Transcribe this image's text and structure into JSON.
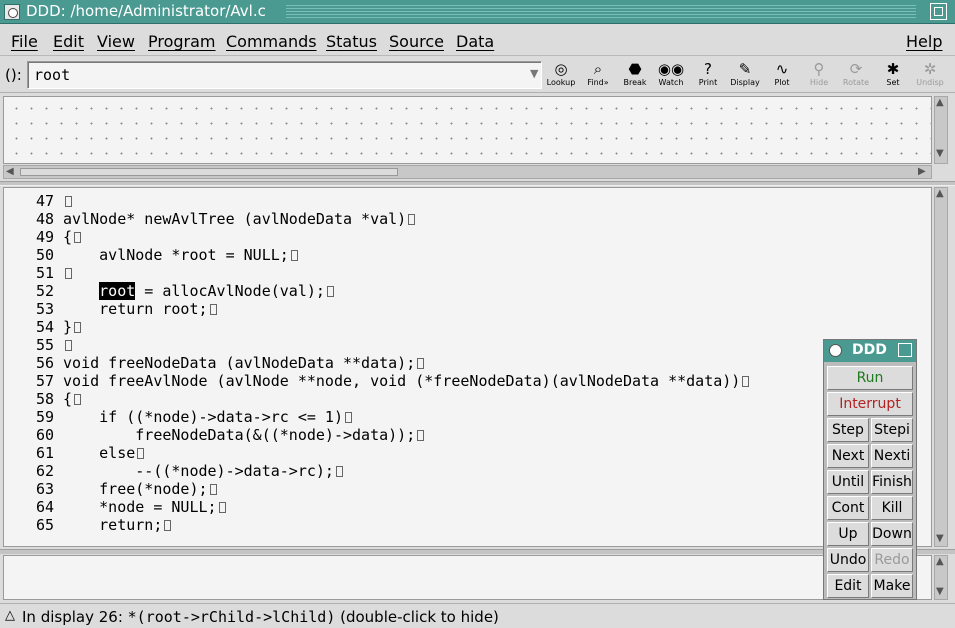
{
  "window": {
    "title": "DDD: /home/Administrator/Avl.c"
  },
  "menubar": {
    "items": [
      "File",
      "Edit",
      "View",
      "Program",
      "Commands",
      "Status",
      "Source",
      "Data"
    ],
    "help": "Help"
  },
  "toolbar": {
    "arg_label": "():",
    "arg_value": "root",
    "buttons": [
      {
        "label": "Lookup",
        "icon": "lookup-icon"
      },
      {
        "label": "Find»",
        "icon": "find-icon"
      },
      {
        "label": "Break",
        "icon": "break-icon"
      },
      {
        "label": "Watch",
        "icon": "watch-icon"
      },
      {
        "label": "Print",
        "icon": "print-icon"
      },
      {
        "label": "Display",
        "icon": "display-icon"
      },
      {
        "label": "Plot",
        "icon": "plot-icon"
      },
      {
        "label": "Hide",
        "icon": "hide-icon",
        "disabled": true
      },
      {
        "label": "Rotate",
        "icon": "rotate-icon",
        "disabled": true
      },
      {
        "label": "Set",
        "icon": "set-icon"
      },
      {
        "label": "Undisp",
        "icon": "undisp-icon",
        "disabled": true
      }
    ]
  },
  "source": {
    "lines": [
      {
        "num": "47",
        "pre": "",
        "hl": "",
        "post": ""
      },
      {
        "num": "48",
        "pre": "avlNode* newAvlTree (avlNodeData *val)",
        "hl": "",
        "post": ""
      },
      {
        "num": "49",
        "pre": "{",
        "hl": "",
        "post": ""
      },
      {
        "num": "50",
        "pre": "    avlNode *root = NULL;",
        "hl": "",
        "post": ""
      },
      {
        "num": "51",
        "pre": "",
        "hl": "",
        "post": ""
      },
      {
        "num": "52",
        "pre": "    ",
        "hl": "root",
        "post": " = allocAvlNode(val);"
      },
      {
        "num": "53",
        "pre": "    return root;",
        "hl": "",
        "post": ""
      },
      {
        "num": "54",
        "pre": "}",
        "hl": "",
        "post": ""
      },
      {
        "num": "55",
        "pre": "",
        "hl": "",
        "post": ""
      },
      {
        "num": "56",
        "pre": "void freeNodeData (avlNodeData **data);",
        "hl": "",
        "post": ""
      },
      {
        "num": "57",
        "pre": "void freeAvlNode (avlNode **node, void (*freeNodeData)(avlNodeData **data))",
        "hl": "",
        "post": ""
      },
      {
        "num": "58",
        "pre": "{",
        "hl": "",
        "post": ""
      },
      {
        "num": "59",
        "pre": "    if ((*node)->data->rc <= 1)",
        "hl": "",
        "post": ""
      },
      {
        "num": "60",
        "pre": "        freeNodeData(&((*node)->data));",
        "hl": "",
        "post": ""
      },
      {
        "num": "61",
        "pre": "    else",
        "hl": "",
        "post": ""
      },
      {
        "num": "62",
        "pre": "        --((*node)->data->rc);",
        "hl": "",
        "post": ""
      },
      {
        "num": "63",
        "pre": "    free(*node);",
        "hl": "",
        "post": ""
      },
      {
        "num": "64",
        "pre": "    *node = NULL;",
        "hl": "",
        "post": ""
      },
      {
        "num": "65",
        "pre": "    return;",
        "hl": "",
        "post": ""
      }
    ]
  },
  "status": {
    "prefix": "In display 26: ",
    "expr": "*(root->rChild->lChild)",
    "suffix": " (double-click to hide)"
  },
  "command_tool": {
    "title": "DDD",
    "run": "Run",
    "interrupt": "Interrupt",
    "buttons": [
      "Step",
      "Stepi",
      "Next",
      "Nexti",
      "Until",
      "Finish",
      "Cont",
      "Kill",
      "Up",
      "Down",
      "Undo",
      "Redo",
      "Edit",
      "Make"
    ],
    "disabled": [
      "Redo"
    ]
  },
  "colors": {
    "title_bar": "#4a9a92",
    "run": "#1f7a1f",
    "interrupt": "#b22222"
  }
}
